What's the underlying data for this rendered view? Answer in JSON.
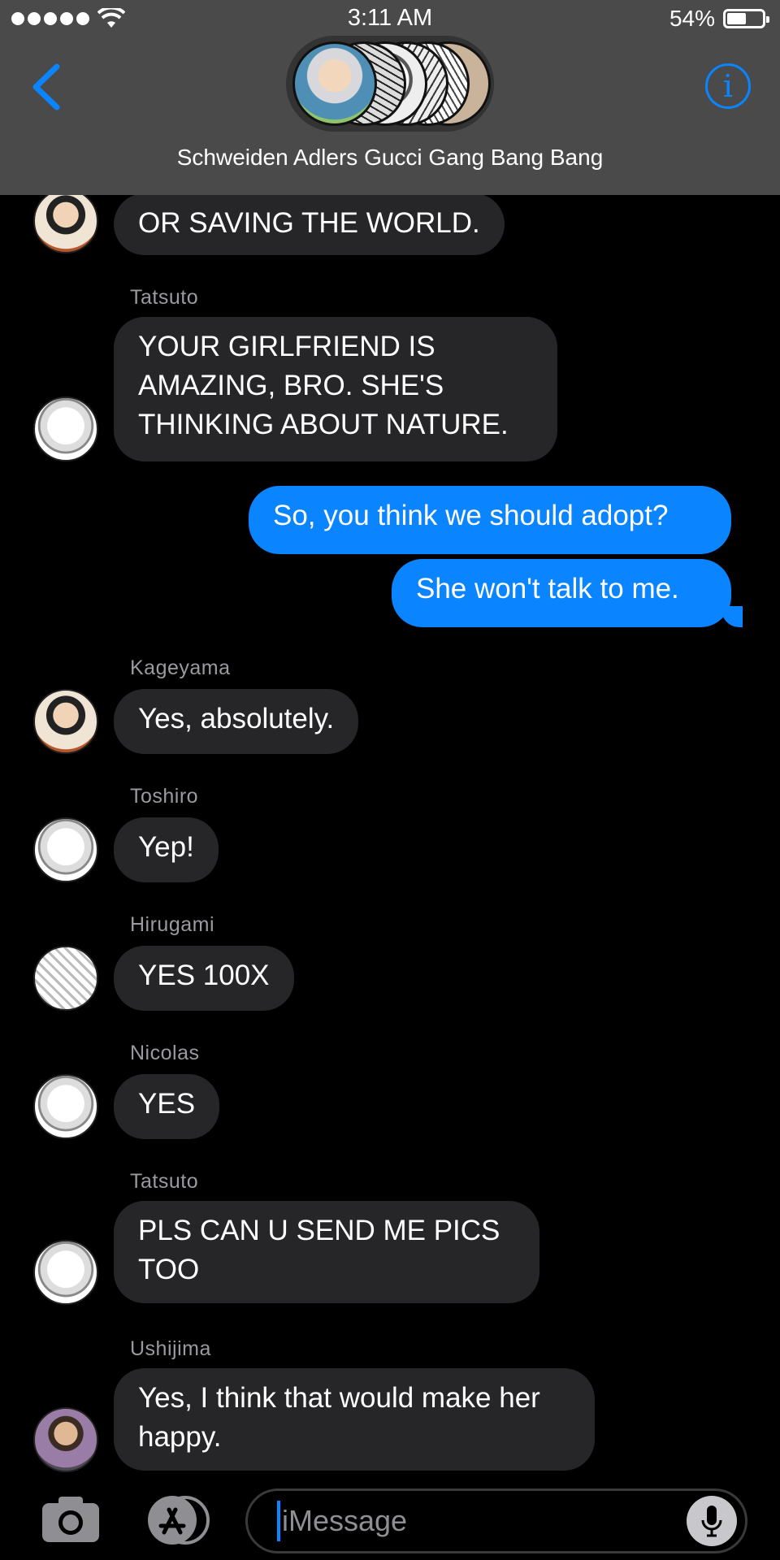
{
  "status": {
    "time": "3:11 AM",
    "battery": "54%",
    "battery_level": 0.54
  },
  "header": {
    "back_icon": "chevron-left-icon",
    "info_icon": "info-icon",
    "group_name": "Schweiden Adlers Gucci Gang Bang Bang"
  },
  "messages": [
    {
      "sender": "",
      "text": "OR SAVING THE WORLD.",
      "direction": "in"
    },
    {
      "sender": "Tatsuto",
      "text": "YOUR GIRLFRIEND IS AMAZING, BRO. SHE'S THINKING ABOUT NATURE.",
      "direction": "in"
    },
    {
      "sender": "",
      "text": "So, you think we should adopt?",
      "direction": "out"
    },
    {
      "sender": "",
      "text": "She won't talk to me.",
      "direction": "out"
    },
    {
      "sender": "Kageyama",
      "text": "Yes, absolutely.",
      "direction": "in"
    },
    {
      "sender": "Toshiro",
      "text": "Yep!",
      "direction": "in"
    },
    {
      "sender": "Hirugami",
      "text": "YES 100X",
      "direction": "in"
    },
    {
      "sender": "Nicolas",
      "text": "YES",
      "direction": "in"
    },
    {
      "sender": "Tatsuto",
      "text": "PLS CAN U SEND ME PICS TOO",
      "direction": "in"
    },
    {
      "sender": "Ushijima",
      "text": "Yes, I think that would make her happy.",
      "direction": "in"
    }
  ],
  "composer": {
    "placeholder": "iMessage",
    "camera_icon": "camera-icon",
    "apps_icon": "app-store-icon",
    "mic_icon": "microphone-icon"
  },
  "colors": {
    "accent": "#0a84ff",
    "header_bg": "#4a4a4a",
    "incoming_bubble": "#262629",
    "outgoing_bubble": "#0a84ff"
  }
}
